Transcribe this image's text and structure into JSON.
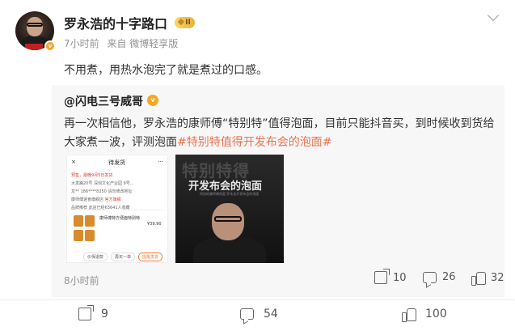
{
  "author": {
    "name": "罗永浩的十字路口",
    "level_badge": "II",
    "time": "7小时前",
    "source": "来自 微博轻享版"
  },
  "post": {
    "text": "不用煮，用热水泡完了就是煮过的口感。"
  },
  "repost": {
    "user": "@闪电三号威哥",
    "text_main": "再一次相信他，罗永浩的康师傅“特别特”值得泡面，目前只能抖音买，到时候收到货给大家煮一波，评测泡面",
    "hashtag": "#特别特值得开发布会的泡面#",
    "time": "8小时前",
    "shares": "10",
    "comments": "26",
    "likes": "32",
    "image1": {
      "close": "×",
      "title": "待发货",
      "presale": "预售，最晚9月5日发货",
      "address": "大发路20号 深圳文化产业园 9号...",
      "phone": "龙**  186****8250  请勿修改地址",
      "shop": "康师傅速食旗舰店",
      "shop_tag": "官方旗舰",
      "desc": "品牌推荐 此店已经63641人收藏",
      "product": "康师傅特方便面特别特",
      "price": "¥39.90",
      "btn1": "价保退款",
      "btn2": "再买一单",
      "btn3": "提醒发货"
    },
    "image2": {
      "big": "特别特得",
      "sub": "开发布会的泡面",
      "tiny": "特别的康师傅泡面 罗永浩开发布会的泡面"
    }
  },
  "actions": {
    "shares": "9",
    "comments": "54",
    "likes": "100"
  },
  "colors": {
    "hashtag": "#eb7350",
    "badge": "#f5a623"
  }
}
